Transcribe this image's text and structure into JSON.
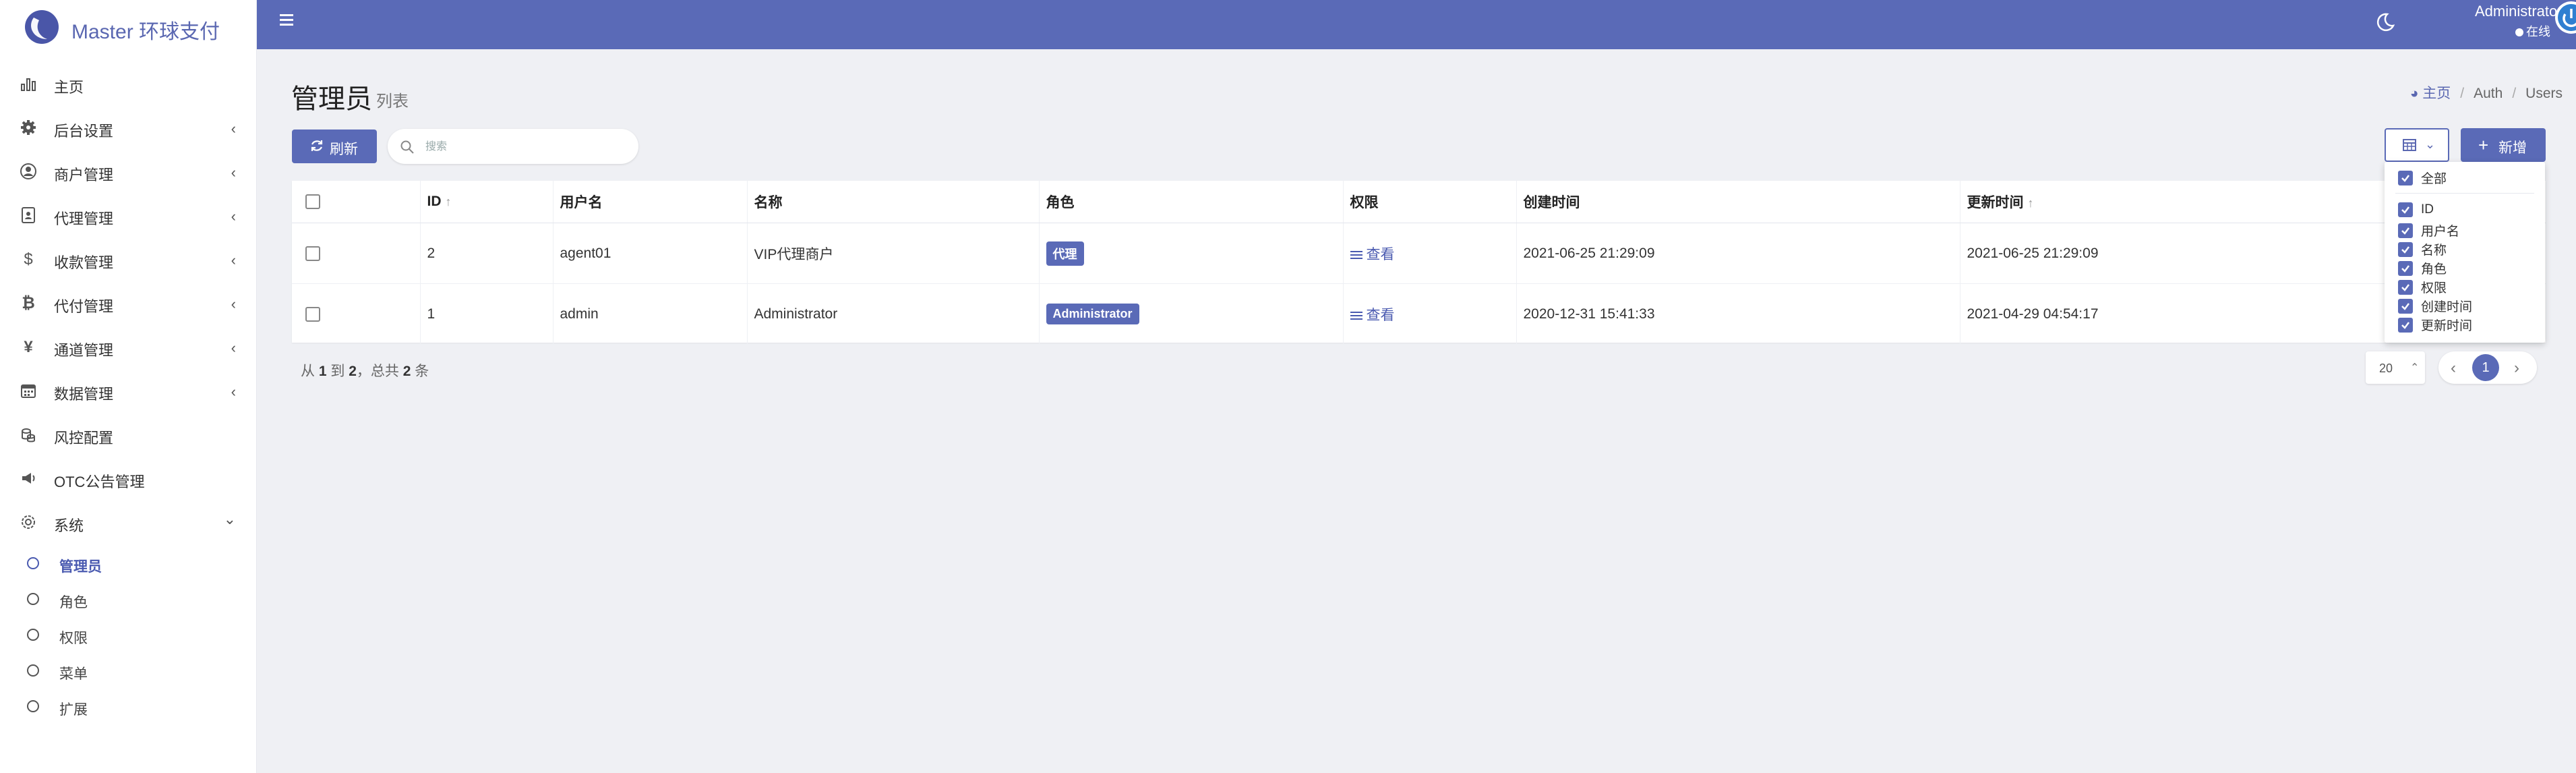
{
  "app": {
    "title": "Master 环球支付"
  },
  "sidebar": {
    "items": [
      {
        "label": "主页",
        "icon": "bar-chart-icon",
        "chevron": ""
      },
      {
        "label": "后台设置",
        "icon": "gear-icon",
        "chevron": "‹"
      },
      {
        "label": "商户管理",
        "icon": "user-circle-icon",
        "chevron": "‹"
      },
      {
        "label": "代理管理",
        "icon": "id-card-icon",
        "chevron": "‹"
      },
      {
        "label": "收款管理",
        "icon": "dollar-icon",
        "chevron": "‹"
      },
      {
        "label": "代付管理",
        "icon": "bitcoin-icon",
        "chevron": "‹"
      },
      {
        "label": "通道管理",
        "icon": "yen-icon",
        "chevron": "‹"
      },
      {
        "label": "数据管理",
        "icon": "calendar-icon",
        "chevron": "‹"
      },
      {
        "label": "风控配置",
        "icon": "coins-icon",
        "chevron": ""
      },
      {
        "label": "OTC公告管理",
        "icon": "megaphone-icon",
        "chevron": ""
      },
      {
        "label": "系统",
        "icon": "cog-icon",
        "chevron": "⌄"
      }
    ],
    "sub_items": [
      {
        "label": "管理员",
        "active": true
      },
      {
        "label": "角色",
        "active": false
      },
      {
        "label": "权限",
        "active": false
      },
      {
        "label": "菜单",
        "active": false
      },
      {
        "label": "扩展",
        "active": false
      }
    ]
  },
  "topbar": {
    "user_name": "Administrator",
    "user_status": "在线"
  },
  "header": {
    "title": "管理员",
    "subtitle": "列表",
    "breadcrumb": [
      "主页",
      "Auth",
      "Users"
    ]
  },
  "toolbar": {
    "refresh_label": "刷新",
    "search_placeholder": "搜索",
    "add_label": "新增"
  },
  "table": {
    "columns": [
      "ID",
      "用户名",
      "名称",
      "角色",
      "权限",
      "创建时间",
      "更新时间"
    ],
    "rows": [
      {
        "id": "2",
        "username": "agent01",
        "name": "VIP代理商户",
        "role": "代理",
        "perm": "查看",
        "created": "2021-06-25 21:29:09",
        "updated": "2021-06-25 21:29:09"
      },
      {
        "id": "1",
        "username": "admin",
        "name": "Administrator",
        "role": "Administrator",
        "perm": "查看",
        "created": "2020-12-31 15:41:33",
        "updated": "2021-04-29 04:54:17"
      }
    ]
  },
  "footer": {
    "summary_prefix": "从",
    "from": "1",
    "to_text": "到",
    "to": "2",
    "total_text": "，总共",
    "total": "2",
    "unit": "条",
    "per_page": "20",
    "current_page": "1"
  },
  "column_selector": {
    "all_label": "全部",
    "items": [
      "ID",
      "用户名",
      "名称",
      "角色",
      "权限",
      "创建时间",
      "更新时间"
    ]
  },
  "colors": {
    "primary": "#5a6ab7",
    "sidebar_bg": "#ffffff",
    "page_bg": "#eff0f4"
  }
}
